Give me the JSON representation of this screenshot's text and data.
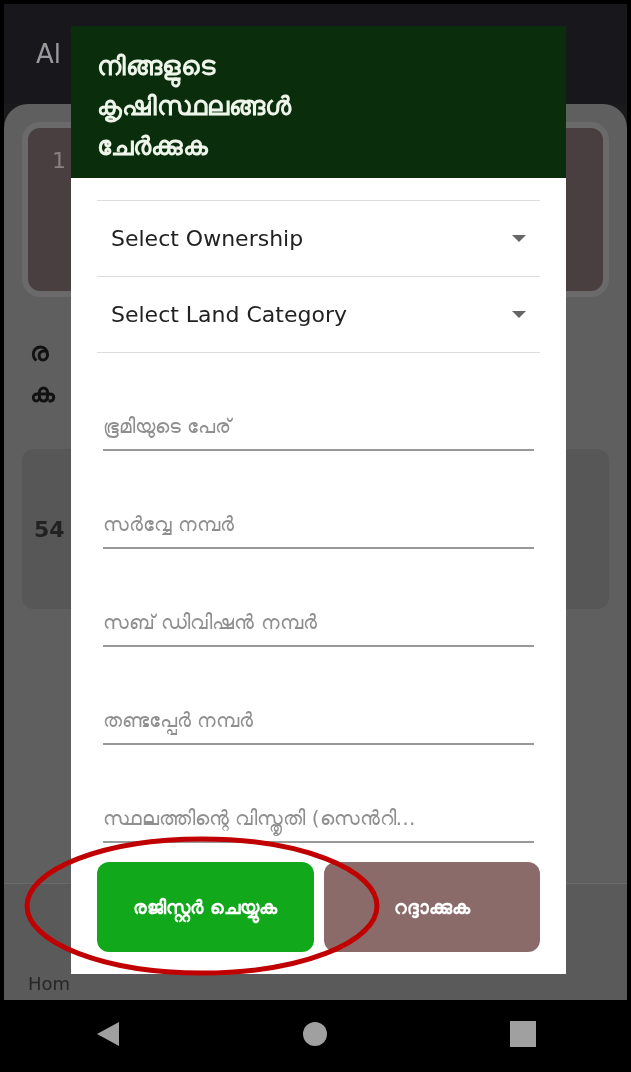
{
  "background": {
    "app_title": "Al",
    "card_number": "1",
    "heading_fragment": "ര",
    "heading_fragment_2": "ക",
    "item_value": "54",
    "nav_label": "Hom"
  },
  "dialog": {
    "title": "നിങ്ങളുടെ കൃഷിസ്ഥലങ്ങൾ ചേർക്കുക",
    "fields": [
      {
        "kind": "dropdown",
        "value": "Select Ownership"
      },
      {
        "kind": "dropdown",
        "value": "Select Land Category"
      },
      {
        "kind": "text",
        "placeholder": "ഭൂമിയുടെ പേര്"
      },
      {
        "kind": "text",
        "placeholder": "സർവ്വേ നമ്പർ"
      },
      {
        "kind": "text",
        "placeholder": "സബ് ഡിവിഷൻ നമ്പർ"
      },
      {
        "kind": "text",
        "placeholder": "തണ്ടപ്പേർ നമ്പർ"
      },
      {
        "kind": "text",
        "placeholder": "സ്ഥലത്തിന്റെ വിസ്തൃതി (സെൻറി…"
      }
    ],
    "buttons": [
      {
        "kind": "primary",
        "label": "രജിസ്റ്റർ ചെയ്യുക"
      },
      {
        "kind": "secondary",
        "label": "റദ്ദാക്കുക"
      }
    ]
  }
}
